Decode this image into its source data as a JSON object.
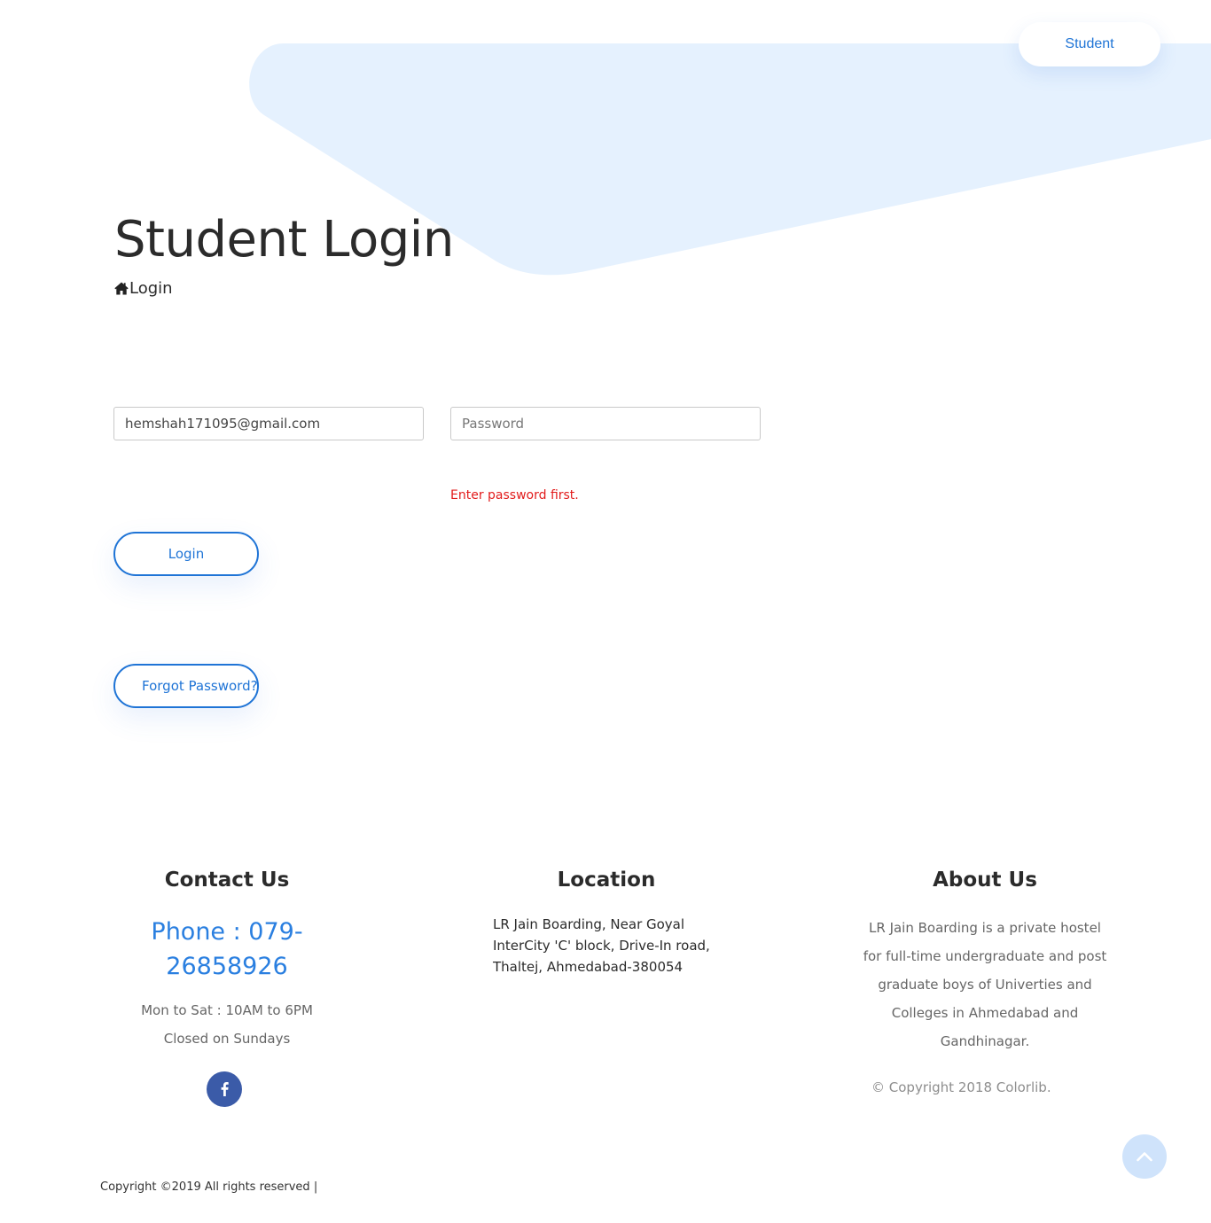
{
  "nav": {
    "student_label": "Student"
  },
  "header": {
    "title": "Student Login",
    "breadcrumb_label": "Login",
    "breadcrumb_icon": "home-icon"
  },
  "form": {
    "email_value": "hemshah171095@gmail.com",
    "password_placeholder": "Password",
    "error_message": "Enter password first.",
    "login_label": "Login",
    "forgot_label": "Forgot Password?"
  },
  "footer": {
    "contact": {
      "heading": "Contact Us",
      "phone": "Phone : 079-26858926",
      "hours": "Mon to Sat : 10AM to 6PM",
      "closed": "Closed on Sundays",
      "social_icon": "facebook-icon"
    },
    "location": {
      "heading": "Location",
      "address": "LR Jain Boarding, Near Goyal InterCity 'C' block, Drive-In road, Thaltej, Ahmedabad-380054"
    },
    "about": {
      "heading": "About Us",
      "text": "LR Jain Boarding is a private hostel for full-time undergraduate and post graduate boys of Univerties and Colleges in Ahmedabad and Gandhinagar.",
      "copyright_prefix": "© Copyright 2018",
      "copyright_brand": "Colorlib."
    },
    "bottom_copyright": "Copyright ©2019 All rights reserved |"
  },
  "colors": {
    "accent": "#1f74d6",
    "error": "#e21c1c",
    "hero_shape": "#e5f1fe",
    "facebook": "#3b5ba8"
  }
}
